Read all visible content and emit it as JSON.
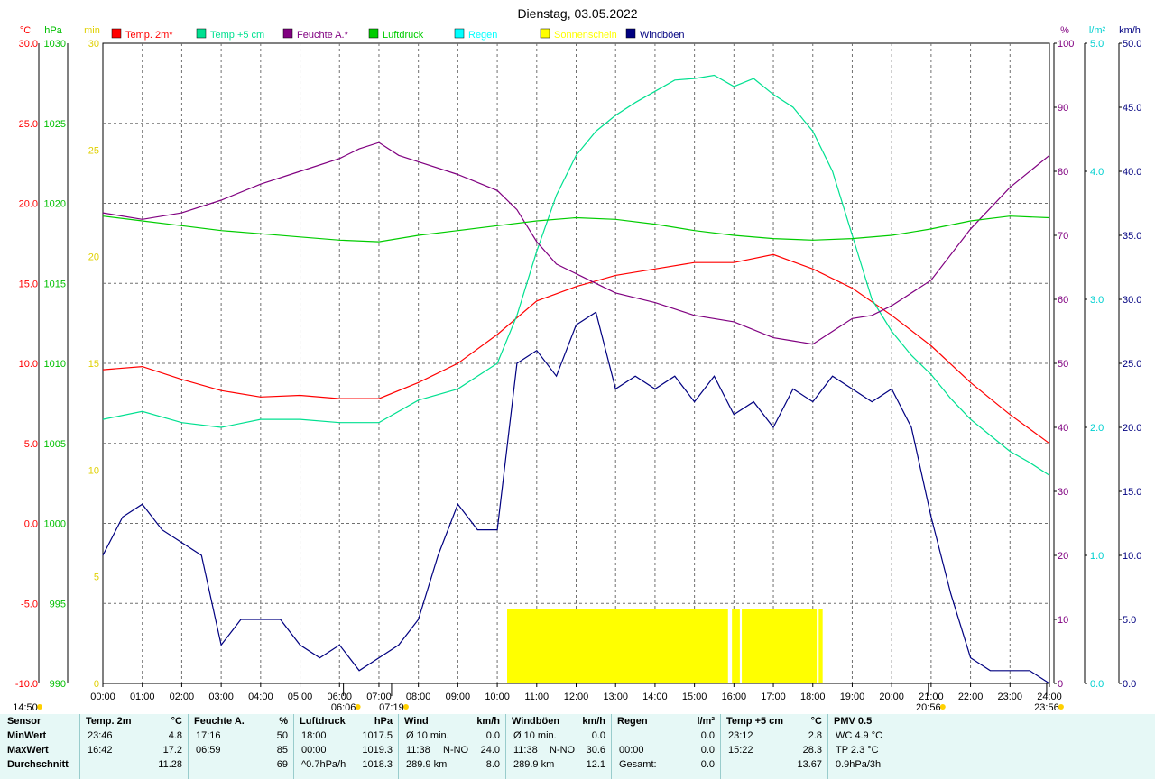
{
  "chart_data": {
    "type": "line",
    "title": "Dienstag, 03.05.2022",
    "x_labels": [
      "00:00",
      "01:00",
      "02:00",
      "03:00",
      "04:00",
      "05:00",
      "06:00",
      "07:00",
      "08:00",
      "09:00",
      "10:00",
      "11:00",
      "12:00",
      "13:00",
      "14:00",
      "15:00",
      "16:00",
      "17:00",
      "18:00",
      "19:00",
      "20:00",
      "21:00",
      "22:00",
      "23:00",
      "24:00"
    ],
    "xlim": [
      0,
      24
    ],
    "grid": true,
    "legend_position": "top",
    "left_axes": [
      {
        "unit": "°C",
        "color": "#ff0000",
        "range": [
          -10,
          30
        ],
        "ticks": [
          "30.0",
          "25.0",
          "20.0",
          "15.0",
          "10.0",
          "5.0",
          "0.0",
          "-5.0",
          "-10.0"
        ]
      },
      {
        "unit": "hPa",
        "color": "#00c000",
        "range": [
          990,
          1030
        ],
        "ticks": [
          "1030",
          "1025",
          "1020",
          "1015",
          "1010",
          "1005",
          "1000",
          "995",
          "990"
        ]
      },
      {
        "unit": "min",
        "color": "#e0d000",
        "range": [
          0,
          30
        ],
        "ticks": [
          "30",
          "25",
          "20",
          "15",
          "10",
          "5",
          "0"
        ]
      }
    ],
    "right_axes": [
      {
        "unit": "%",
        "color": "#800080",
        "range": [
          0,
          100
        ],
        "ticks": [
          "100",
          "90",
          "80",
          "70",
          "60",
          "50",
          "40",
          "30",
          "20",
          "10",
          "0"
        ]
      },
      {
        "unit": "l/m²",
        "color": "#00d0d0",
        "range": [
          0,
          5
        ],
        "ticks": [
          "5.0",
          "4.0",
          "3.0",
          "2.0",
          "1.0",
          "0.0"
        ]
      },
      {
        "unit": "km/h",
        "color": "#000080",
        "range": [
          0,
          50
        ],
        "ticks": [
          "50.0",
          "45.0",
          "40.0",
          "35.0",
          "30.0",
          "25.0",
          "20.0",
          "15.0",
          "10.0",
          "5.0",
          "0.0"
        ]
      }
    ],
    "series": [
      {
        "name": "Temp. 2m*",
        "color": "#ff0000",
        "axis": "°C",
        "x": [
          0,
          1,
          2,
          3,
          4,
          5,
          6,
          7,
          8,
          9,
          10,
          11,
          12,
          13,
          14,
          15,
          16,
          17,
          18,
          19,
          20,
          21,
          22,
          23,
          24
        ],
        "y": [
          9.6,
          9.8,
          9.0,
          8.3,
          7.9,
          8.0,
          7.8,
          7.8,
          8.8,
          10.0,
          11.8,
          13.9,
          14.8,
          15.5,
          15.9,
          16.3,
          16.3,
          16.8,
          15.9,
          14.7,
          13.0,
          11.1,
          8.8,
          6.8,
          5.0
        ]
      },
      {
        "name": "Temp +5 cm",
        "color": "#00e090",
        "axis": "°C",
        "x": [
          0,
          1,
          2,
          3,
          4,
          5,
          6,
          7,
          8,
          9,
          10,
          10.5,
          11,
          11.5,
          12,
          12.5,
          13,
          13.5,
          14,
          14.5,
          15,
          15.5,
          16,
          16.5,
          17,
          17.5,
          18,
          18.5,
          19,
          19.5,
          20,
          20.5,
          21,
          21.5,
          22,
          22.5,
          23,
          23.5,
          24
        ],
        "y": [
          6.5,
          7.0,
          6.3,
          6.0,
          6.5,
          6.5,
          6.3,
          6.3,
          7.7,
          8.4,
          10.0,
          13.0,
          17.0,
          20.5,
          23.0,
          24.5,
          25.5,
          26.3,
          27.0,
          27.7,
          27.8,
          28.0,
          27.3,
          27.8,
          26.8,
          26.0,
          24.5,
          22.0,
          18.0,
          14.0,
          12.0,
          10.5,
          9.3,
          7.8,
          6.5,
          5.5,
          4.5,
          3.8,
          3.0
        ]
      },
      {
        "name": "Feuchte A.*",
        "color": "#800080",
        "axis": "%",
        "x": [
          0,
          1,
          2,
          3,
          4,
          5,
          6,
          6.5,
          7,
          7.5,
          8,
          9,
          10,
          10.5,
          11,
          11.5,
          12,
          12.5,
          13,
          14,
          15,
          16,
          17,
          17.5,
          18,
          18.5,
          19,
          19.5,
          20,
          21,
          22,
          23,
          24
        ],
        "y": [
          73.5,
          72.5,
          73.5,
          75.5,
          78.0,
          80.0,
          82.0,
          83.5,
          84.5,
          82.5,
          81.5,
          79.5,
          77.0,
          74.0,
          69.0,
          65.5,
          64.0,
          62.5,
          61.0,
          59.5,
          57.5,
          56.5,
          54.0,
          53.5,
          53.0,
          55.0,
          57.0,
          57.5,
          59.0,
          63.0,
          71.0,
          77.5,
          82.5
        ]
      },
      {
        "name": "Luftdruck",
        "color": "#00cc00",
        "axis": "hPa",
        "x": [
          0,
          1,
          2,
          3,
          4,
          5,
          6,
          7,
          8,
          9,
          10,
          11,
          12,
          13,
          14,
          15,
          16,
          17,
          18,
          19,
          20,
          21,
          22,
          23,
          24
        ],
        "y": [
          1019.2,
          1018.9,
          1018.6,
          1018.3,
          1018.1,
          1017.9,
          1017.7,
          1017.6,
          1018.0,
          1018.3,
          1018.6,
          1018.9,
          1019.1,
          1019.0,
          1018.7,
          1018.3,
          1018.0,
          1017.8,
          1017.7,
          1017.8,
          1018.0,
          1018.4,
          1018.9,
          1019.2,
          1019.1
        ]
      },
      {
        "name": "Regen",
        "color": "#00ffff",
        "axis": "l/m²",
        "x": [],
        "y": []
      },
      {
        "name": "Sonnenschein",
        "color": "#ffff00",
        "axis": "min",
        "type": "bar",
        "segments": [
          [
            10.25,
            15.85
          ],
          [
            15.95,
            16.15
          ],
          [
            16.2,
            18.1
          ],
          [
            18.15,
            18.25
          ]
        ],
        "value": 3.5
      },
      {
        "name": "Windböen",
        "color": "#000080",
        "axis": "km/h",
        "x": [
          0,
          0.5,
          1,
          1.5,
          2,
          2.5,
          3,
          3.5,
          4,
          4.5,
          5,
          5.5,
          6,
          6.5,
          7,
          7.5,
          8,
          8.5,
          9,
          9.5,
          10,
          10.5,
          11,
          11.5,
          12,
          12.5,
          13,
          13.5,
          14,
          14.5,
          15,
          15.5,
          16,
          16.5,
          17,
          17.5,
          18,
          18.5,
          19,
          19.5,
          20,
          20.5,
          21,
          21.5,
          22,
          22.5,
          23,
          23.5,
          24
        ],
        "y": [
          10,
          13,
          14,
          12,
          11,
          10,
          3,
          5,
          5,
          5,
          3,
          2,
          3,
          1,
          2,
          3,
          5,
          10,
          14,
          12,
          12,
          25,
          26,
          24,
          28,
          29,
          23,
          24,
          23,
          24,
          22,
          24,
          21,
          22,
          20,
          23,
          22,
          24,
          23,
          22,
          23,
          20,
          13,
          7,
          2,
          1,
          1,
          1,
          0
        ]
      }
    ],
    "markers": [
      {
        "label": "14:50",
        "x": 0,
        "icon": "sun"
      },
      {
        "label": "06:06",
        "x": 6.1,
        "icon": "sun"
      },
      {
        "label": "07:19",
        "x": 7.32,
        "icon": "sun"
      },
      {
        "label": "20:56",
        "x": 20.93,
        "icon": "sun"
      },
      {
        "label": "23:56",
        "x": 23.93,
        "icon": "sun"
      }
    ]
  },
  "summary": {
    "row_labels": [
      "Sensor",
      "MinWert",
      "MaxWert",
      "Durchschnitt"
    ],
    "columns": [
      {
        "title": "Temp. 2m",
        "unit": "°C",
        "rows": [
          [
            "23:46",
            "4.8"
          ],
          [
            "16:42",
            "17.2"
          ],
          [
            "",
            "11.28"
          ]
        ]
      },
      {
        "title": "Feuchte A.",
        "unit": "%",
        "rows": [
          [
            "17:16",
            "50"
          ],
          [
            "06:59",
            "85"
          ],
          [
            "",
            "69"
          ]
        ]
      },
      {
        "title": "Luftdruck",
        "unit": "hPa",
        "rows": [
          [
            "18:00",
            "1017.5"
          ],
          [
            "00:00",
            "1019.3"
          ],
          [
            "^0.7hPa/h",
            "1018.3"
          ]
        ]
      },
      {
        "title": "Wind",
        "unit": "km/h",
        "rows": [
          [
            "Ø 10 min.",
            "",
            "0.0"
          ],
          [
            "11:38",
            "N-NO",
            "24.0"
          ],
          [
            "289.9 km",
            "",
            "8.0"
          ]
        ]
      },
      {
        "title": "Windböen",
        "unit": "km/h",
        "rows": [
          [
            "Ø 10 min.",
            "",
            "0.0"
          ],
          [
            "11:38",
            "N-NO",
            "30.6"
          ],
          [
            "289.9 km",
            "",
            "12.1"
          ]
        ]
      },
      {
        "title": "Regen",
        "unit": "l/m²",
        "rows": [
          [
            "",
            "0.0"
          ],
          [
            "00:00",
            "0.0"
          ],
          [
            "Gesamt:",
            "0.0"
          ]
        ]
      },
      {
        "title": "Temp +5 cm",
        "unit": "°C",
        "rows": [
          [
            "23:12",
            "2.8"
          ],
          [
            "15:22",
            "28.3"
          ],
          [
            "",
            "13.67"
          ]
        ]
      },
      {
        "title": "PMV 0.5",
        "unit": "",
        "rows": [
          [
            "WC 4.9 °C",
            ""
          ],
          [
            "TP 2.3 °C",
            ""
          ],
          [
            "0.9hPa/3h",
            ""
          ]
        ]
      }
    ]
  }
}
